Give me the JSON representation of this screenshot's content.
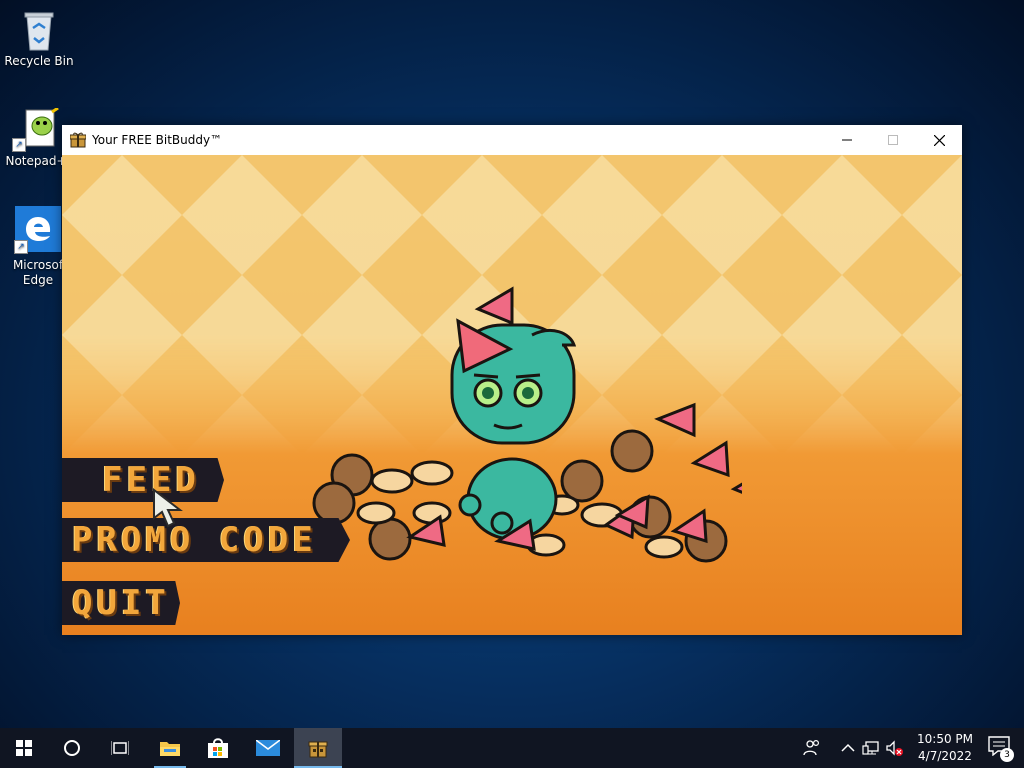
{
  "desktop": {
    "icons": [
      {
        "label": "Recycle Bin",
        "icon": "recycle-bin-icon"
      },
      {
        "label": "Notepad+",
        "icon": "notepad-plus-icon"
      },
      {
        "label": "Microsof Edge",
        "icon": "edge-icon"
      }
    ]
  },
  "window": {
    "title": "Your FREE BitBuddy™",
    "icon": "gift-box-icon",
    "controls": {
      "minimize": "minimize-icon",
      "maximize": "maximize-icon",
      "close": "close-icon"
    }
  },
  "game": {
    "menu": {
      "feed": "FEED",
      "promo": "PROMO CODE",
      "quit": "QUIT"
    },
    "colors": {
      "menu_bg": "#1d1a24",
      "menu_text": "#f2a63b",
      "pet": "#3bb8a0",
      "background": "#f0a23a"
    }
  },
  "taskbar": {
    "apps": [
      "start-icon",
      "cortana-search-icon",
      "task-view-icon",
      "file-explorer-icon",
      "microsoft-store-icon",
      "mail-icon",
      "bitbuddy-icon"
    ],
    "clock": {
      "time": "10:50 PM",
      "date": "4/7/2022"
    },
    "notification_count": "3"
  }
}
